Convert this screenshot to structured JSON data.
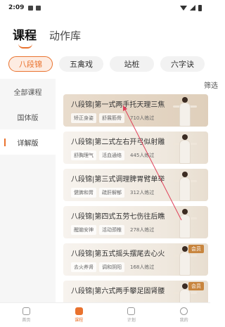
{
  "status_bar": {
    "time": "2:09"
  },
  "top_tabs": [
    {
      "label": "课程"
    },
    {
      "label": "动作库"
    }
  ],
  "chips": [
    {
      "label": "八段锦"
    },
    {
      "label": "五禽戏"
    },
    {
      "label": "站桩"
    },
    {
      "label": "六字诀"
    }
  ],
  "sidebar": {
    "items": [
      {
        "label": "全部课程"
      },
      {
        "label": "国体版"
      },
      {
        "label": "详解版"
      }
    ]
  },
  "filter_label": "筛选",
  "courses": [
    {
      "title": "八段锦|第一式两手托天理三焦",
      "tags": [
        "矫正身姿",
        "舒展筋骨"
      ],
      "count": "710人练过",
      "vip": ""
    },
    {
      "title": "八段锦|第二式左右开弓似射雕",
      "tags": [
        "舒胸理气",
        "活血通络"
      ],
      "count": "445人练过",
      "vip": ""
    },
    {
      "title": "八段锦|第三式调理脾胃臂单举",
      "tags": [
        "健脾和胃",
        "疏肝解郁"
      ],
      "count": "312人练过",
      "vip": ""
    },
    {
      "title": "八段锦|第四式五劳七伤往后瞧",
      "tags": [
        "醒脑安神",
        "活动颈椎"
      ],
      "count": "278人练过",
      "vip": ""
    },
    {
      "title": "八段锦|第五式摇头摆尾去心火",
      "tags": [
        "去火养肾",
        "调和阴阳"
      ],
      "count": "168人练过",
      "vip": "会员"
    },
    {
      "title": "八段锦|第六式两手攀足固肾腰",
      "tags": [],
      "count": "",
      "vip": "会员"
    }
  ],
  "bottom_nav": [
    {
      "label": "首页"
    },
    {
      "label": "课程"
    },
    {
      "label": "计划"
    },
    {
      "label": "我的"
    }
  ],
  "colors": {
    "accent": "#e9722e",
    "vip": "#c8853e",
    "arrow": "#e0405a"
  }
}
